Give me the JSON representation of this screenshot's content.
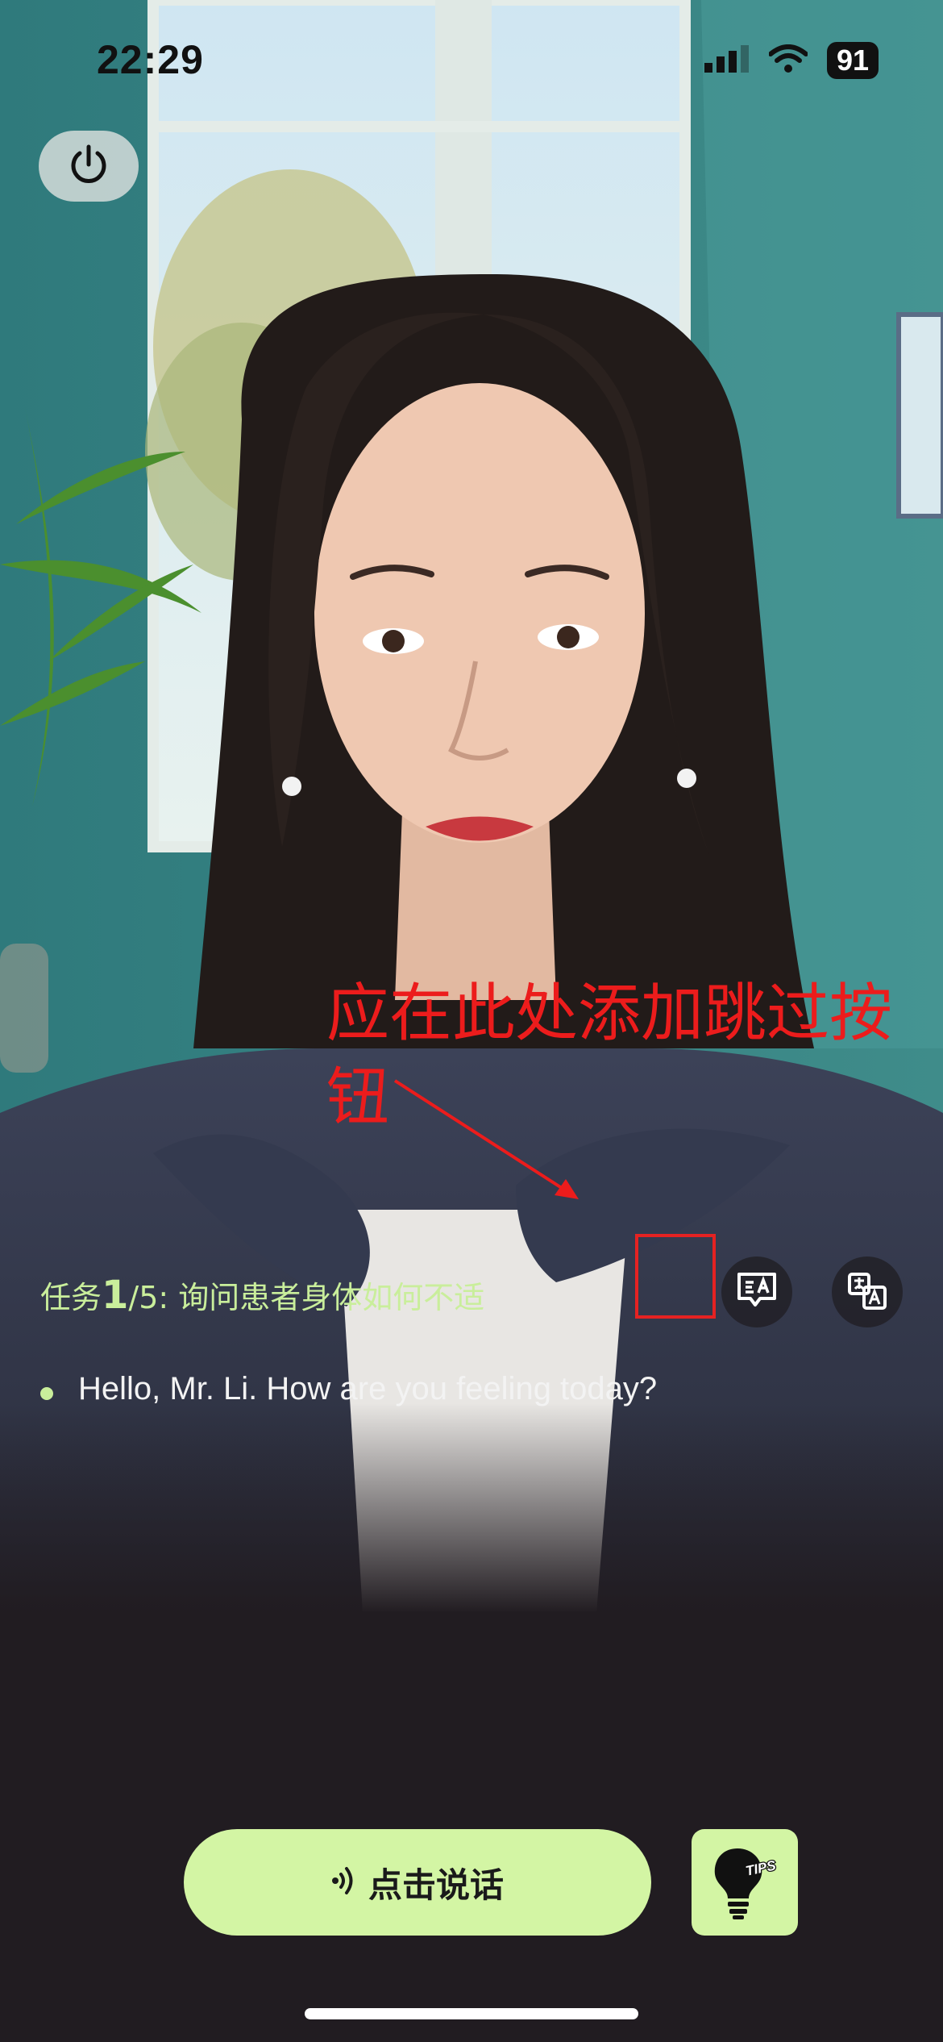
{
  "status_bar": {
    "time": "22:29",
    "battery": "91"
  },
  "annotation": {
    "text": "应在此处添加跳过按钮"
  },
  "task": {
    "prefix": "任务",
    "current": "1",
    "total_suffix": "/5: ",
    "description": "询问患者身体如何不适"
  },
  "dialogue": {
    "sentence": "Hello, Mr. Li. How are you feeling today?"
  },
  "controls": {
    "talk_label": "点击说话",
    "tips_badge": "TIPS"
  },
  "icons": {
    "power": "power-icon",
    "subtitle": "subtitle-translate-icon",
    "translate": "translate-icon",
    "microphone": "sound-wave-icon",
    "tips": "lightbulb-icon"
  },
  "colors": {
    "accent": "#d3f5a4",
    "task_text": "#c9ee9b",
    "annotation": "#ec1c1c",
    "background": "#211c21"
  }
}
